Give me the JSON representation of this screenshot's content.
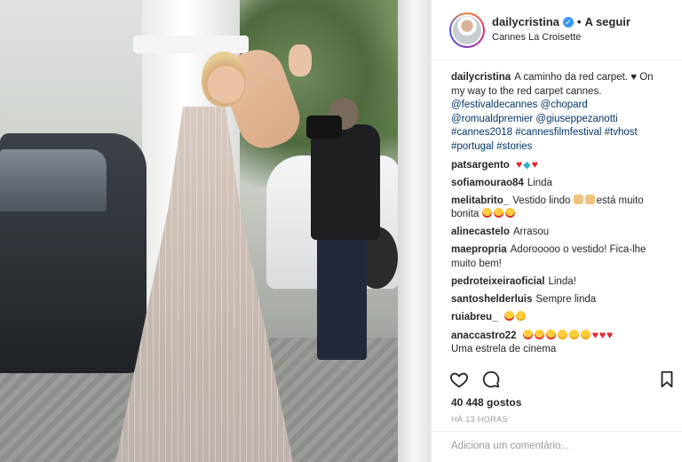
{
  "post": {
    "username": "dailycristina",
    "verified_mark": "✓",
    "separator": "•",
    "follow_label": "A seguir",
    "location": "Cannes La Croisette"
  },
  "caption": {
    "username": "dailycristina",
    "text_line1": "A caminho da red carpet. ",
    "heart": "♥",
    "text_line2": " On my way to the red carpet cannes.",
    "tags": "@festivaldecannes @chopard @romualdpremier @giuseppezanotti #cannes2018 #cannesfilmfestival #tvhost #portugal #stories"
  },
  "comments": [
    {
      "user": "patsargento",
      "text": ""
    },
    {
      "user": "sofiamourao84",
      "text": "Linda"
    },
    {
      "user": "melitabrito_",
      "text": "Vestido lindo ",
      "text2": "está muito bonita "
    },
    {
      "user": "alinecastelo",
      "text": "Arrasou"
    },
    {
      "user": "maepropria",
      "text": "Adorooooo o vestido! Fica-lhe muito bem!"
    },
    {
      "user": "pedroteixeiraoficial",
      "text": "Linda!"
    },
    {
      "user": "santoshelderluis",
      "text": "Sempre linda"
    },
    {
      "user": "ruiabreu_",
      "text": ""
    },
    {
      "user": "anaccastro22",
      "text": "",
      "text2": "Uma estrela de cinema"
    }
  ],
  "icons": {
    "heart": "heart-outline-icon",
    "comment": "comment-bubble-icon",
    "bookmark": "bookmark-icon",
    "verified": "verified-badge-icon"
  },
  "likes_label": "40 448 gostos",
  "time_label": "HÁ 13 HORAS",
  "add_comment": {
    "placeholder": "Adiciona um comentário..."
  },
  "colors": {
    "link": "#003569",
    "verified": "#3897f0",
    "heart": "#e3262f"
  }
}
